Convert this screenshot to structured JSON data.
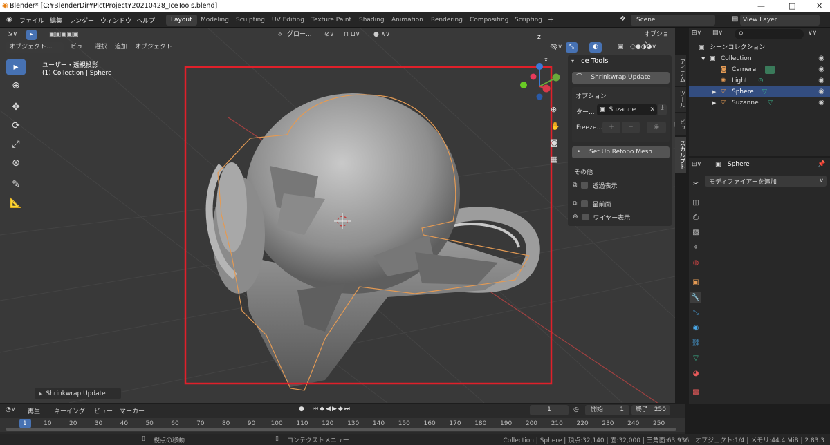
{
  "window": {
    "title": "Blender* [C:¥BlenderDir¥PictProject¥20210428_IceTools.blend]",
    "minimize": "—",
    "maximize": "□",
    "close": "✕"
  },
  "menubar": {
    "items": [
      "ファイル",
      "編集",
      "レンダー",
      "ウィンドウ",
      "ヘルプ"
    ]
  },
  "workspaces": {
    "tabs": [
      "Layout",
      "Modeling",
      "Sculpting",
      "UV Editing",
      "Texture Paint",
      "Shading",
      "Animation",
      "Rendering",
      "Compositing",
      "Scripting"
    ],
    "active": "Layout",
    "add": "+"
  },
  "scene": {
    "name": "Scene",
    "view_layer": "View Layer"
  },
  "viewport": {
    "mode": "オブジェクト...",
    "menus": [
      "ビュー",
      "選択",
      "追加",
      "オブジェクト"
    ],
    "transform_orientation": "グロー...",
    "options": "オプション",
    "view_name": "ユーザー・透視投影",
    "collection_info": "(1) Collection | Sphere",
    "operator_panel": "Shrinkwrap Update"
  },
  "gizmo": {
    "z": "Z",
    "y": "Y",
    "x": "X"
  },
  "npanel": {
    "header": "Ice Tools",
    "shrinkwrap_button": "Shrinkwrap Update",
    "options_label": "オプション",
    "target_label": "ター...",
    "target_value": "Suzanne",
    "freeze_label": "Freeze...",
    "retopo_button": "Set Up Retopo Mesh",
    "other_label": "その他",
    "checkboxes": [
      "透過表示",
      "最前面",
      "ワイヤー表示"
    ],
    "tabs": [
      "アイテム",
      "ツール",
      "ビュー",
      "スカルプト"
    ]
  },
  "outliner": {
    "scene_collection": "シーンコレクション",
    "collection": "Collection",
    "items": [
      "Camera",
      "Light",
      "Sphere",
      "Suzanne"
    ]
  },
  "properties": {
    "object_name": "Sphere",
    "add_modifier": "モディファイアーを追加"
  },
  "timeline": {
    "menus": [
      "再生",
      "キーイング",
      "ビュー",
      "マーカー"
    ],
    "current_frame": "1",
    "start_label": "開始",
    "start": "1",
    "end_label": "終了",
    "end": "250",
    "ticks": [
      "1",
      "10",
      "20",
      "30",
      "40",
      "50",
      "60",
      "70",
      "80",
      "90",
      "100",
      "110",
      "120",
      "130",
      "140",
      "150",
      "160",
      "170",
      "180",
      "190",
      "200",
      "210",
      "220",
      "230",
      "240",
      "250"
    ]
  },
  "status": {
    "left": "視点の移動",
    "middle": "コンテクストメニュー",
    "right": "Collection | Sphere | 頂点:32,140 | 面:32,000 | 三角面:63,936 | オブジェクト:1/4 | メモリ:44.4 MiB | 2.83.3"
  },
  "colors": {
    "accent": "#4772b3",
    "selection_box": "#e0202a",
    "object_outline": "#e39a54"
  }
}
